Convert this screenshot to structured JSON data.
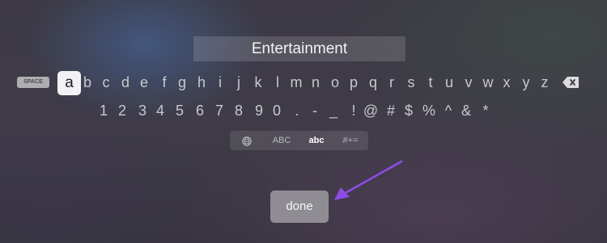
{
  "search": {
    "text": "Entertainment"
  },
  "keyboard": {
    "space_label": "SPACE",
    "selected_key": "a",
    "letters": [
      "b",
      "c",
      "d",
      "e",
      "f",
      "g",
      "h",
      "i",
      "j",
      "k",
      "l",
      "m",
      "n",
      "o",
      "p",
      "q",
      "r",
      "s",
      "t",
      "u",
      "v",
      "w",
      "x",
      "y",
      "z"
    ],
    "symbols": [
      "1",
      "2",
      "3",
      "4",
      "5",
      "6",
      "7",
      "8",
      "9",
      "0",
      ".",
      "-",
      "_",
      "!",
      "@",
      "#",
      "$",
      "%",
      "^",
      "&",
      "*"
    ],
    "delete_icon": "delete-backspace-icon"
  },
  "modes": {
    "globe_icon": "globe-icon",
    "upper": "ABC",
    "lower": "abc",
    "symbols": "#+=",
    "active": "abc"
  },
  "actions": {
    "done_label": "done"
  },
  "annotation": {
    "arrow_icon": "pointer-arrow-icon",
    "arrow_color": "#8f4be6"
  }
}
